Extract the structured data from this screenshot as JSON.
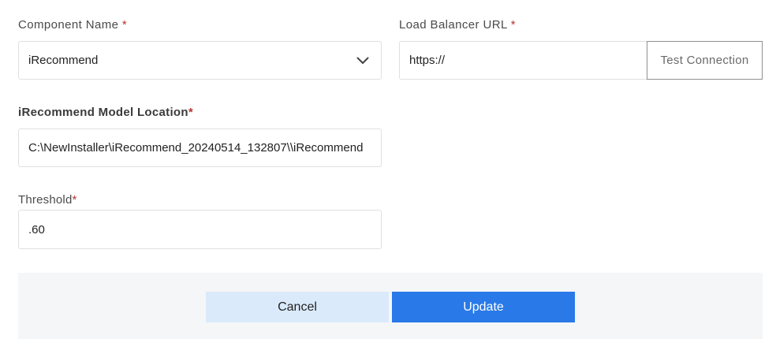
{
  "component": {
    "label": "Component Name",
    "required_mark": "*",
    "value": "iRecommend",
    "chevron_icon": "chevron-down-icon"
  },
  "load_balancer": {
    "label": "Load Balancer URL",
    "required_mark": "*",
    "value": "https://",
    "test_button_label": "Test Connection"
  },
  "model_location": {
    "label": "iRecommend Model Location",
    "required_mark": "*",
    "value": "C:\\NewInstaller\\iRecommend_20240514_132807\\\\iRecommend"
  },
  "threshold": {
    "label": "Threshold",
    "required_mark": "*",
    "value": ".60"
  },
  "actions": {
    "cancel_label": "Cancel",
    "update_label": "Update"
  },
  "colors": {
    "required": "#b53333",
    "update_button": "#2979e8",
    "cancel_button": "#dbeafa",
    "footer_background": "#f4f6f8"
  }
}
